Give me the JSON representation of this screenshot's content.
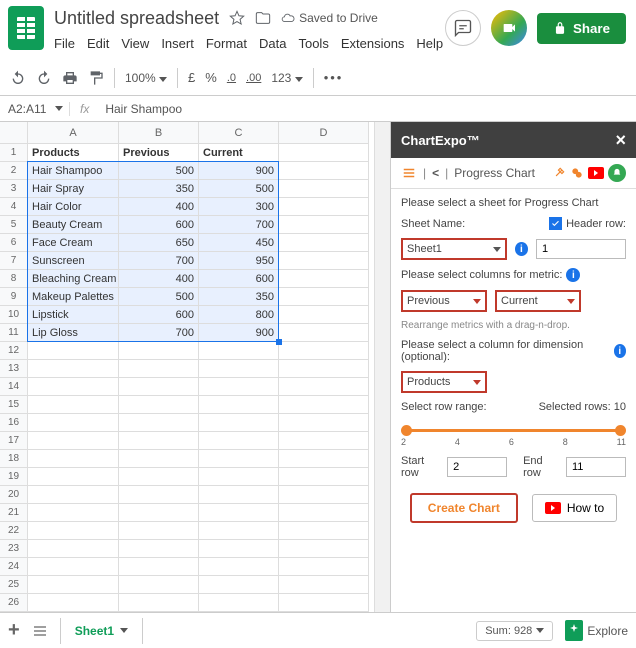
{
  "header": {
    "title": "Untitled spreadsheet",
    "saved": "Saved to Drive",
    "menus": [
      "File",
      "Edit",
      "View",
      "Insert",
      "Format",
      "Data",
      "Tools",
      "Extensions",
      "Help"
    ],
    "share": "Share"
  },
  "toolbar": {
    "zoom": "100%",
    "curr": "£",
    "pct": "%",
    "dec0": ".0",
    "dec00": ".00",
    "num": "123"
  },
  "fx": {
    "namebox": "A2:A11",
    "fx_label": "fx",
    "value": "Hair Shampoo"
  },
  "columns": [
    "A",
    "B",
    "C",
    "D"
  ],
  "table": {
    "headers": [
      "Products",
      "Previous",
      "Current"
    ],
    "rows": [
      {
        "p": "Hair Shampoo",
        "prev": 500,
        "curr": 900
      },
      {
        "p": "Hair Spray",
        "prev": 350,
        "curr": 500
      },
      {
        "p": "Hair Color",
        "prev": 400,
        "curr": 300
      },
      {
        "p": "Beauty Cream",
        "prev": 600,
        "curr": 700
      },
      {
        "p": "Face Cream",
        "prev": 650,
        "curr": 450
      },
      {
        "p": "Sunscreen",
        "prev": 700,
        "curr": 950
      },
      {
        "p": "Bleaching Cream",
        "prev": 400,
        "curr": 600
      },
      {
        "p": "Makeup Palettes",
        "prev": 500,
        "curr": 350
      },
      {
        "p": "Lipstick",
        "prev": 600,
        "curr": 800
      },
      {
        "p": "Lip Gloss",
        "prev": 700,
        "curr": 900
      }
    ]
  },
  "sidepanel": {
    "title": "ChartExpo™",
    "subtitle": "Progress Chart",
    "select_sheet_label": "Please select a sheet for Progress Chart",
    "sheet_name_label": "Sheet Name:",
    "header_row_label": "Header row:",
    "sheet_value": "Sheet1",
    "header_row_value": "1",
    "metric_label": "Please select columns for metric:",
    "metric1": "Previous",
    "metric2": "Current",
    "rearrange_hint": "Rearrange metrics with a drag-n-drop.",
    "dimension_label": "Please select a column for dimension (optional):",
    "dimension_value": "Products",
    "range_label": "Select row range:",
    "selected_label": "Selected rows: 10",
    "ticks": [
      "2",
      "4",
      "6",
      "8",
      "11"
    ],
    "start_row_label": "Start row",
    "start_row_value": "2",
    "end_row_label": "End row",
    "end_row_value": "11",
    "create": "Create Chart",
    "howto": "How to"
  },
  "bottom": {
    "sheet_tab": "Sheet1",
    "sum": "Sum: 928",
    "explore": "Explore"
  },
  "chart_data": {
    "type": "bar",
    "categories": [
      "Hair Shampoo",
      "Hair Spray",
      "Hair Color",
      "Beauty Cream",
      "Face Cream",
      "Sunscreen",
      "Bleaching Cream",
      "Makeup Palettes",
      "Lipstick",
      "Lip Gloss"
    ],
    "series": [
      {
        "name": "Previous",
        "values": [
          500,
          350,
          400,
          600,
          650,
          700,
          400,
          500,
          600,
          700
        ]
      },
      {
        "name": "Current",
        "values": [
          900,
          500,
          300,
          700,
          450,
          950,
          600,
          350,
          800,
          900
        ]
      }
    ],
    "title": "Progress Chart"
  }
}
